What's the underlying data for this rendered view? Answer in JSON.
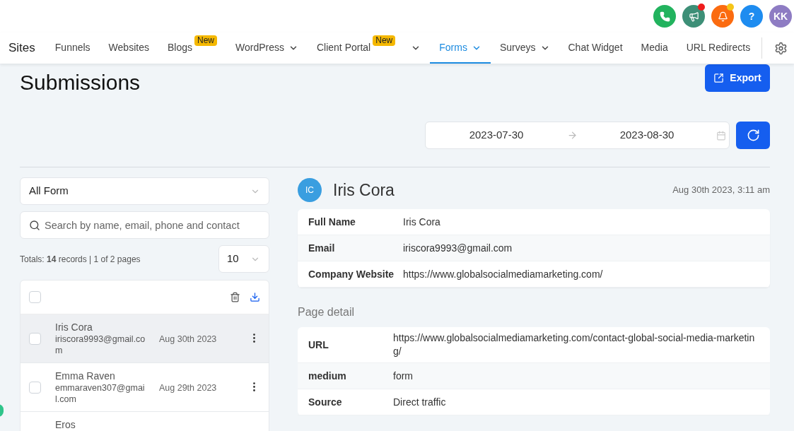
{
  "header_icons": [
    {
      "kind": "phone",
      "color": "#22b35e",
      "notification": false
    },
    {
      "kind": "megaphone",
      "color": "#3d8f77",
      "notification": true
    },
    {
      "kind": "bell",
      "color": "#fb6b10",
      "notification": true
    },
    {
      "kind": "help",
      "label": "?",
      "color": "#1e8cf0",
      "notification": false
    },
    {
      "kind": "avatar",
      "label": "KK",
      "color": "#8e7cc3",
      "notification": false
    }
  ],
  "nav": {
    "title": "Sites",
    "items": [
      {
        "label": "Funnels",
        "dropdown": false,
        "selected": false
      },
      {
        "label": "Websites",
        "dropdown": false,
        "selected": false
      },
      {
        "label": "Blogs",
        "badge": "New",
        "dropdown": false,
        "selected": false
      },
      {
        "label": "WordPress",
        "dropdown": true,
        "selected": false
      },
      {
        "label": "Client Portal",
        "badge": "New",
        "dropdown": true,
        "selected": false
      },
      {
        "label": "Forms",
        "dropdown": true,
        "selected": true
      },
      {
        "label": "Surveys",
        "dropdown": true,
        "selected": false
      },
      {
        "label": "Chat Widget",
        "dropdown": false,
        "selected": false
      },
      {
        "label": "Media",
        "dropdown": false,
        "selected": false
      },
      {
        "label": "URL Redirects",
        "dropdown": false,
        "selected": false
      }
    ]
  },
  "page": {
    "title": "Submissions",
    "export_button": "Export",
    "date_from": "2023-07-30",
    "date_to": "2023-08-30"
  },
  "filters": {
    "form_select": "All Form",
    "search": {
      "placeholder": "Search by name, email, phone and contact"
    },
    "totals": "Totals: **14** records | 1 of 2 pages",
    "page_size": "10"
  },
  "list": {
    "select_all_checked": false,
    "rows": [
      {
        "name": "Iris Cora",
        "email": "iriscora9993@gmail.com",
        "date": "Aug 30th 2023",
        "checked": false,
        "selected": true
      },
      {
        "name": "Emma Raven",
        "email": "emmaraven307@gmail.com",
        "date": "Aug 29th 2023",
        "checked": false,
        "selected": false
      },
      {
        "name": "Eros",
        "selected": false
      }
    ]
  },
  "detail": {
    "initials": "IC",
    "name": "Iris Cora",
    "timestamp": "Aug 30th 2023, 3:11 am",
    "fields": [
      {
        "label": "Full Name",
        "value": "Iris Cora"
      },
      {
        "label": "Email",
        "value": "iriscora9993@gmail.com"
      },
      {
        "label": "Company Website",
        "value": "https://www.globalsocialmediamarketing.com/"
      }
    ],
    "page_detail_title": "Page detail",
    "page_fields": [
      {
        "label": "URL",
        "value": "https://www.globalsocialmediamarketing.com/contact-global-social-media-marketing/"
      },
      {
        "label": "medium",
        "value": "form"
      },
      {
        "label": "Source",
        "value": "Direct traffic"
      }
    ]
  }
}
